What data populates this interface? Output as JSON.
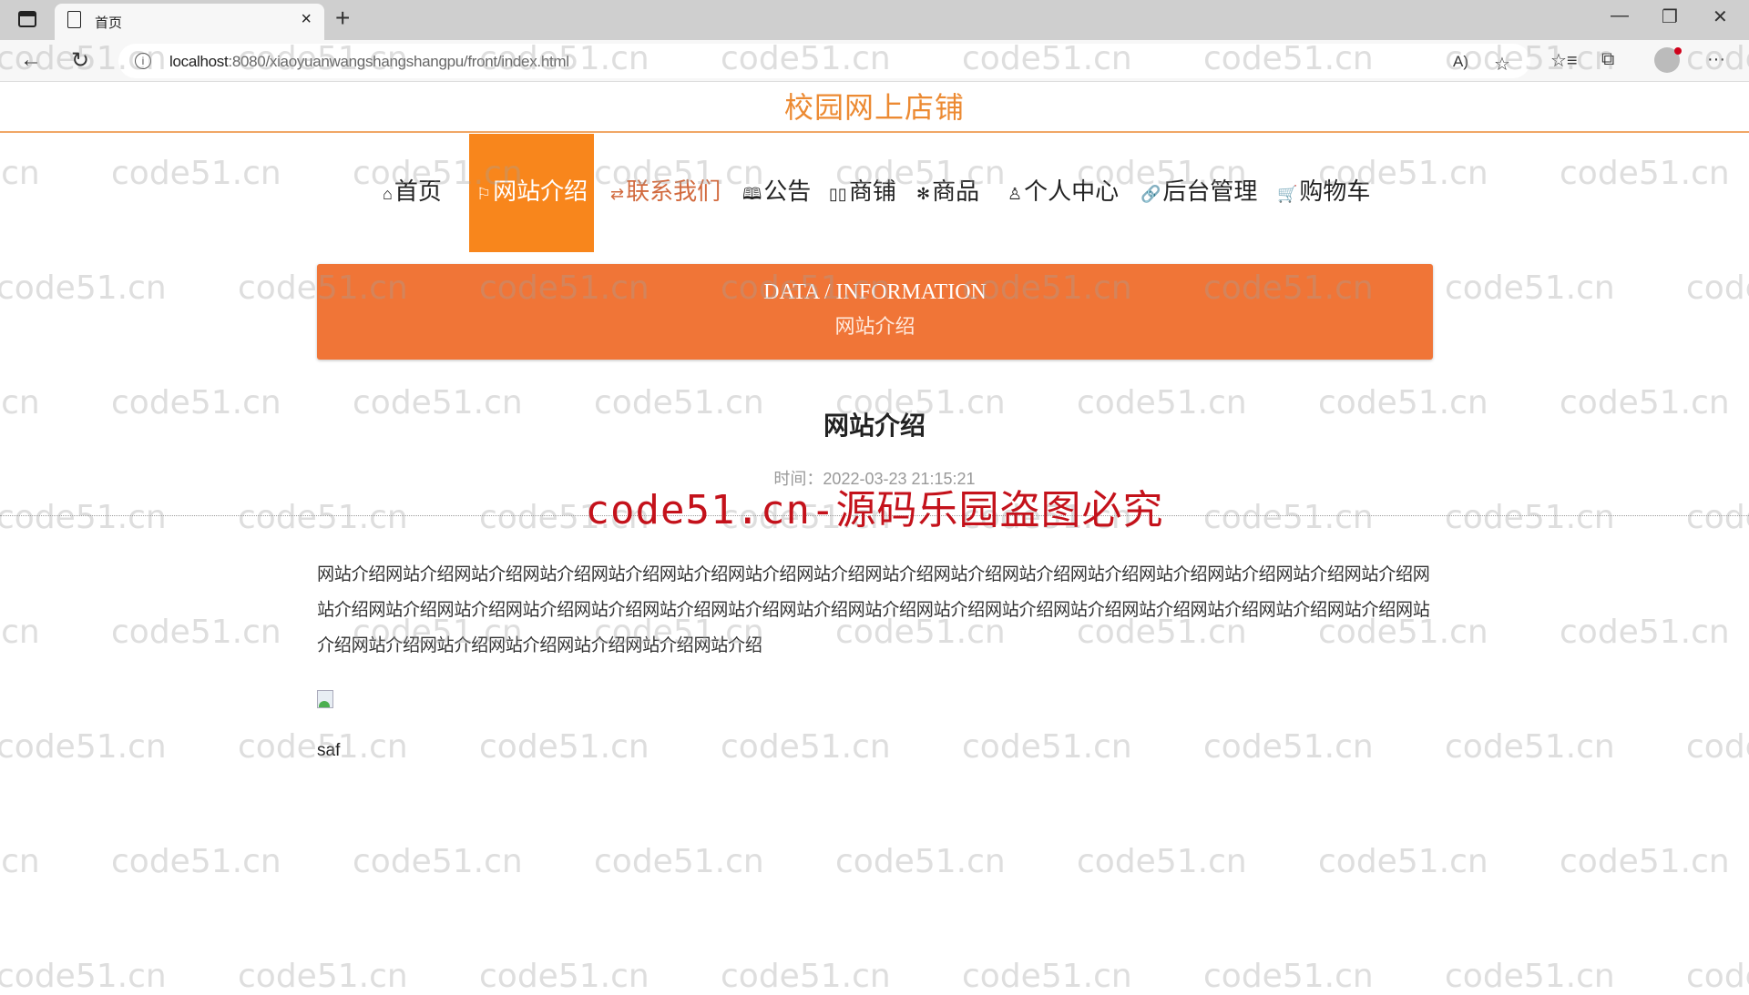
{
  "browser": {
    "tab_title": "首页",
    "tab_close": "×",
    "new_tab": "+",
    "url_host": "localhost",
    "url_rest": ":8080/xiaoyuanwangshangshangpu/front/index.html",
    "window_controls": {
      "minimize": "—",
      "restore": "❐",
      "close": "✕"
    },
    "nav": {
      "back": "←",
      "reload": "↻"
    },
    "info_icon": "i",
    "toolbar_icons": [
      "read-aloud-icon",
      "add-favorite-icon",
      "favorites-icon",
      "collections-icon",
      "profile-avatar",
      "more-icon"
    ],
    "toolbar_glyphs": {
      "read_aloud": "A)",
      "add_favorite": "☆",
      "favorites": "☆≡",
      "collections": "⧉",
      "more": "···"
    }
  },
  "site": {
    "title": "校园网上店铺",
    "accent_color": "#f8861c",
    "banner_color": "#f07537"
  },
  "nav": {
    "items": [
      {
        "icon": "⌂",
        "icon_name": "home-icon",
        "label": "首页"
      },
      {
        "icon": "⚐",
        "icon_name": "flag-icon",
        "label": "网站介绍",
        "active": true
      },
      {
        "icon": "⇄",
        "icon_name": "swap-icon",
        "label": "联系我们",
        "hover": true
      },
      {
        "icon": "🕮",
        "icon_name": "book-icon",
        "label": "公告"
      },
      {
        "icon": "▯▯",
        "icon_name": "columns-icon",
        "label": "商铺"
      },
      {
        "icon": "✻",
        "icon_name": "snowflake-icon",
        "label": "商品"
      },
      {
        "icon": "♙",
        "icon_name": "user-icon",
        "label": "个人中心"
      },
      {
        "icon": "🔗",
        "icon_name": "link-icon",
        "label": "后台管理"
      },
      {
        "icon": "🛒",
        "icon_name": "cart-icon",
        "label": "购物车"
      }
    ]
  },
  "banner": {
    "en": "DATA / INFORMATION",
    "cn": "网站介绍"
  },
  "article": {
    "title": "网站介绍",
    "time": "时间：2022-03-23 21:15:21",
    "body": "网站介绍网站介绍网站介绍网站介绍网站介绍网站介绍网站介绍网站介绍网站介绍网站介绍网站介绍网站介绍网站介绍网站介绍网站介绍网站介绍网站介绍网站介绍网站介绍网站介绍网站介绍网站介绍网站介绍网站介绍网站介绍网站介绍网站介绍网站介绍网站介绍网站介绍网站介绍网站介绍网站介绍网站介绍网站介绍网站介绍网站介绍网站介绍网站介绍",
    "image_alt": "broken-image",
    "caption": "saf"
  },
  "watermark": {
    "text": "code51.cn",
    "red_text": "code51.cn-源码乐园盗图必究"
  }
}
